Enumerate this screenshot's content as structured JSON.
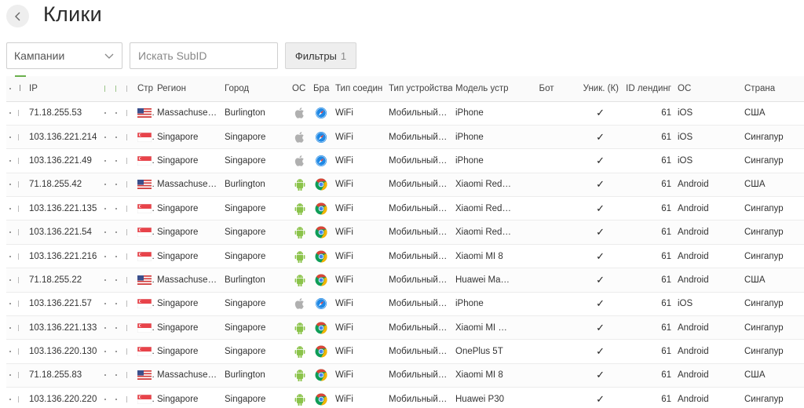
{
  "page": {
    "title": "Клики"
  },
  "toolbar": {
    "campaigns_label": "Кампании",
    "search_placeholder": "Искать SubID",
    "filters_label": "Фильтры",
    "filters_count": "1"
  },
  "columns": {
    "c1": "",
    "c2": "",
    "ip": "IP",
    "c4": "",
    "c5": "",
    "c6": "",
    "country_flag": "Стр",
    "region": "Регион",
    "city": "Город",
    "os_icon": "ОС",
    "browser_icon": "Бра",
    "connection": "Тип соедин",
    "device_type": "Тип устройства",
    "device_model": "Модель устр",
    "bot": "Бот",
    "unique": "Уник. (К)",
    "landing_id": "ID лендинг",
    "os": "ОС",
    "country": "Страна"
  },
  "rows": [
    {
      "ip": "71.18.255.53",
      "flag": "us",
      "region": "Massachuset…",
      "city": "Burlington",
      "os_icon": "apple",
      "browser_icon": "safari",
      "connection": "WiFi",
      "device_type": "Мобильный …",
      "model": "iPhone",
      "bot": "",
      "unique": "✓",
      "landing": "61",
      "os": "iOS",
      "country": "США"
    },
    {
      "ip": "103.136.221.214",
      "flag": "sg",
      "region": "Singapore",
      "city": "Singapore",
      "os_icon": "apple",
      "browser_icon": "safari",
      "connection": "WiFi",
      "device_type": "Мобильный …",
      "model": "iPhone",
      "bot": "",
      "unique": "✓",
      "landing": "61",
      "os": "iOS",
      "country": "Сингапур"
    },
    {
      "ip": "103.136.221.49",
      "flag": "sg",
      "region": "Singapore",
      "city": "Singapore",
      "os_icon": "apple",
      "browser_icon": "safari",
      "connection": "WiFi",
      "device_type": "Мобильный …",
      "model": "iPhone",
      "bot": "",
      "unique": "✓",
      "landing": "61",
      "os": "iOS",
      "country": "Сингапур"
    },
    {
      "ip": "71.18.255.42",
      "flag": "us",
      "region": "Massachuset…",
      "city": "Burlington",
      "os_icon": "android",
      "browser_icon": "chrome",
      "connection": "WiFi",
      "device_type": "Мобильный …",
      "model": "Xiaomi Red…",
      "bot": "",
      "unique": "✓",
      "landing": "61",
      "os": "Android",
      "country": "США"
    },
    {
      "ip": "103.136.221.135",
      "flag": "sg",
      "region": "Singapore",
      "city": "Singapore",
      "os_icon": "android",
      "browser_icon": "chrome",
      "connection": "WiFi",
      "device_type": "Мобильный …",
      "model": "Xiaomi Red…",
      "bot": "",
      "unique": "✓",
      "landing": "61",
      "os": "Android",
      "country": "Сингапур"
    },
    {
      "ip": "103.136.221.54",
      "flag": "sg",
      "region": "Singapore",
      "city": "Singapore",
      "os_icon": "android",
      "browser_icon": "chrome",
      "connection": "WiFi",
      "device_type": "Мобильный …",
      "model": "Xiaomi Red…",
      "bot": "",
      "unique": "✓",
      "landing": "61",
      "os": "Android",
      "country": "Сингапур"
    },
    {
      "ip": "103.136.221.216",
      "flag": "sg",
      "region": "Singapore",
      "city": "Singapore",
      "os_icon": "android",
      "browser_icon": "chrome",
      "connection": "WiFi",
      "device_type": "Мобильный …",
      "model": "Xiaomi MI 8",
      "bot": "",
      "unique": "✓",
      "landing": "61",
      "os": "Android",
      "country": "Сингапур"
    },
    {
      "ip": "71.18.255.22",
      "flag": "us",
      "region": "Massachuset…",
      "city": "Burlington",
      "os_icon": "android",
      "browser_icon": "chrome",
      "connection": "WiFi",
      "device_type": "Мобильный …",
      "model": "Huawei Ma…",
      "bot": "",
      "unique": "✓",
      "landing": "61",
      "os": "Android",
      "country": "США"
    },
    {
      "ip": "103.136.221.57",
      "flag": "sg",
      "region": "Singapore",
      "city": "Singapore",
      "os_icon": "apple",
      "browser_icon": "safari",
      "connection": "WiFi",
      "device_type": "Мобильный …",
      "model": "iPhone",
      "bot": "",
      "unique": "✓",
      "landing": "61",
      "os": "iOS",
      "country": "Сингапур"
    },
    {
      "ip": "103.136.221.133",
      "flag": "sg",
      "region": "Singapore",
      "city": "Singapore",
      "os_icon": "android",
      "browser_icon": "chrome",
      "connection": "WiFi",
      "device_type": "Мобильный …",
      "model": "Xiaomi MI …",
      "bot": "",
      "unique": "✓",
      "landing": "61",
      "os": "Android",
      "country": "Сингапур"
    },
    {
      "ip": "103.136.220.130",
      "flag": "sg",
      "region": "Singapore",
      "city": "Singapore",
      "os_icon": "android",
      "browser_icon": "chrome",
      "connection": "WiFi",
      "device_type": "Мобильный …",
      "model": "OnePlus 5T",
      "bot": "",
      "unique": "✓",
      "landing": "61",
      "os": "Android",
      "country": "Сингапур"
    },
    {
      "ip": "71.18.255.83",
      "flag": "us",
      "region": "Massachuset…",
      "city": "Burlington",
      "os_icon": "android",
      "browser_icon": "chrome",
      "connection": "WiFi",
      "device_type": "Мобильный …",
      "model": "Xiaomi MI 8",
      "bot": "",
      "unique": "✓",
      "landing": "61",
      "os": "Android",
      "country": "США"
    },
    {
      "ip": "103.136.220.220",
      "flag": "sg",
      "region": "Singapore",
      "city": "Singapore",
      "os_icon": "android",
      "browser_icon": "chrome",
      "connection": "WiFi",
      "device_type": "Мобильный …",
      "model": "Huawei P30",
      "bot": "",
      "unique": "✓",
      "landing": "61",
      "os": "Android",
      "country": "Сингапур"
    }
  ],
  "colors": {
    "android": "#8bc34a",
    "apple": "#b0b0b0",
    "chrome_red": "#db4437",
    "chrome_yellow": "#f4b400",
    "chrome_green": "#0f9d58",
    "chrome_blue": "#4285f4",
    "safari_blue": "#1e88e5",
    "accent_green": "#6ab04c"
  }
}
